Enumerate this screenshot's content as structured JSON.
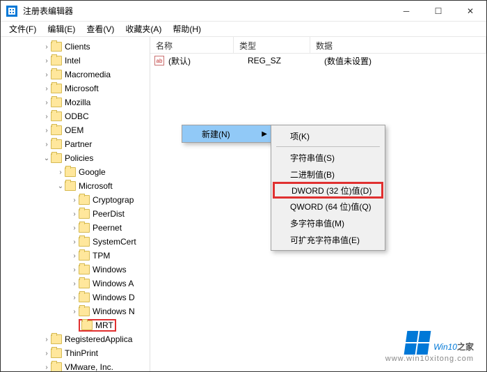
{
  "title": "注册表编辑器",
  "menus": {
    "file": "文件(F)",
    "edit": "编辑(E)",
    "view": "查看(V)",
    "favorites": "收藏夹(A)",
    "help": "帮助(H)"
  },
  "tree": [
    {
      "label": "Clients",
      "indent": 60,
      "chev": "›"
    },
    {
      "label": "Intel",
      "indent": 60,
      "chev": "›"
    },
    {
      "label": "Macromedia",
      "indent": 60,
      "chev": "›"
    },
    {
      "label": "Microsoft",
      "indent": 60,
      "chev": "›"
    },
    {
      "label": "Mozilla",
      "indent": 60,
      "chev": "›"
    },
    {
      "label": "ODBC",
      "indent": 60,
      "chev": "›"
    },
    {
      "label": "OEM",
      "indent": 60,
      "chev": "›"
    },
    {
      "label": "Partner",
      "indent": 60,
      "chev": "›"
    },
    {
      "label": "Policies",
      "indent": 60,
      "chev": "⌄"
    },
    {
      "label": "Google",
      "indent": 80,
      "chev": "›"
    },
    {
      "label": "Microsoft",
      "indent": 80,
      "chev": "⌄"
    },
    {
      "label": "Cryptograp",
      "indent": 100,
      "chev": "›"
    },
    {
      "label": "PeerDist",
      "indent": 100,
      "chev": "›"
    },
    {
      "label": "Peernet",
      "indent": 100,
      "chev": "›"
    },
    {
      "label": "SystemCert",
      "indent": 100,
      "chev": "›"
    },
    {
      "label": "TPM",
      "indent": 100,
      "chev": "›"
    },
    {
      "label": "Windows",
      "indent": 100,
      "chev": "›"
    },
    {
      "label": "Windows A",
      "indent": 100,
      "chev": "›"
    },
    {
      "label": "Windows D",
      "indent": 100,
      "chev": "›"
    },
    {
      "label": "Windows N",
      "indent": 100,
      "chev": "›"
    },
    {
      "label": "MRT",
      "indent": 100,
      "chev": "",
      "hl": true
    },
    {
      "label": "RegisteredApplica",
      "indent": 60,
      "chev": "›"
    },
    {
      "label": "ThinPrint",
      "indent": 60,
      "chev": "›"
    },
    {
      "label": "VMware, Inc.",
      "indent": 60,
      "chev": "›"
    }
  ],
  "list": {
    "headers": {
      "name": "名称",
      "type": "类型",
      "data": "数据"
    },
    "rows": [
      {
        "name": "(默认)",
        "type": "REG_SZ",
        "data": "(数值未设置)"
      }
    ]
  },
  "context": {
    "new": "新建(N)",
    "sub": [
      {
        "t": "项(K)"
      },
      {
        "sep": true
      },
      {
        "t": "字符串值(S)"
      },
      {
        "t": "二进制值(B)"
      },
      {
        "t": "DWORD (32 位)值(D)",
        "hl": true
      },
      {
        "t": "QWORD (64 位)值(Q)"
      },
      {
        "t": "多字符串值(M)"
      },
      {
        "t": "可扩充字符串值(E)"
      }
    ]
  },
  "watermark": {
    "brand_main": "Win",
    "brand_sub": "之家",
    "brand_num": "10",
    "url": "www.win10xitong.com"
  }
}
